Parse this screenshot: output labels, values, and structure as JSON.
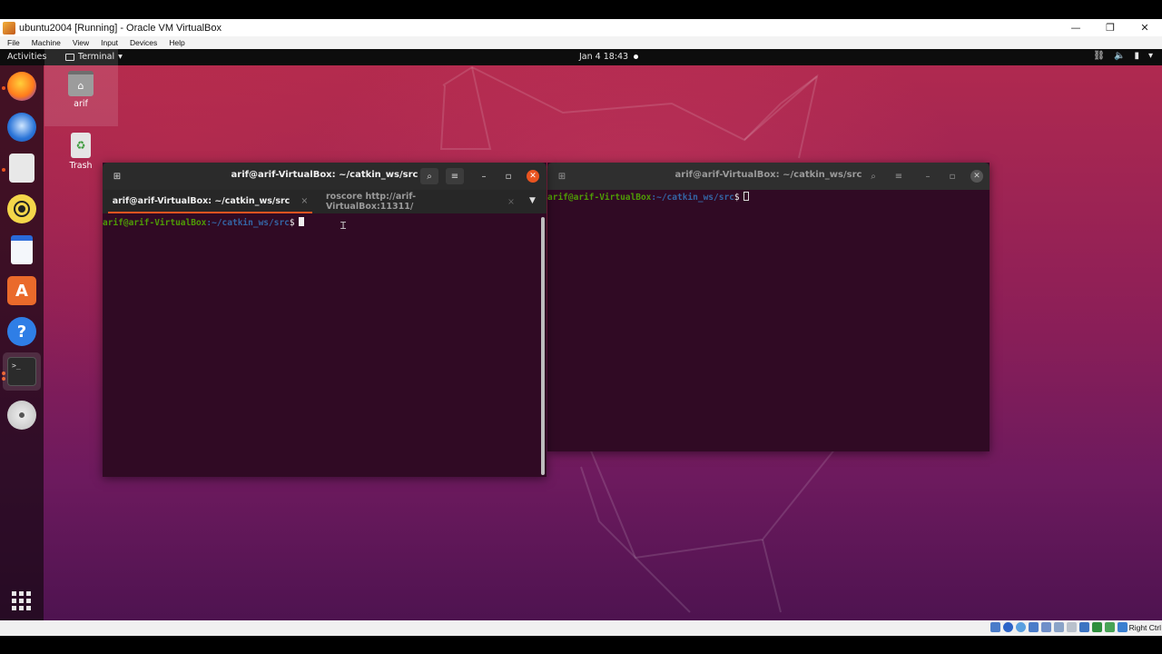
{
  "vbox": {
    "title": "ubuntu2004 [Running] - Oracle VM VirtualBox",
    "menu": [
      "File",
      "Machine",
      "View",
      "Input",
      "Devices",
      "Help"
    ],
    "host_key": "Right Ctrl"
  },
  "topbar": {
    "activities": "Activities",
    "app_menu": "Terminal",
    "clock": "Jan 4  18:43"
  },
  "dock": {
    "items": [
      "firefox-icon",
      "thunderbird-icon",
      "files-icon",
      "rhythmbox-icon",
      "writer-icon",
      "software-icon",
      "help-icon",
      "terminal-icon",
      "dvd-icon",
      "show-apps-icon"
    ]
  },
  "desktop": {
    "home_label": "arif",
    "trash_label": "Trash"
  },
  "terminal_left": {
    "title": "arif@arif-VirtualBox: ~/catkin_ws/src",
    "tabs": [
      {
        "label": "arif@arif-VirtualBox: ~/catkin_ws/src",
        "active": true
      },
      {
        "label": "roscore http://arif-VirtualBox:11311/",
        "active": false
      }
    ],
    "prompt_user": "arif@arif-VirtualBox",
    "prompt_path": ":~/catkin_ws/src",
    "prompt_sym": "$"
  },
  "terminal_right": {
    "title": "arif@arif-VirtualBox: ~/catkin_ws/src",
    "prompt_user": "arif@arif-VirtualBox",
    "prompt_path": ":~/catkin_ws/src",
    "prompt_sym": "$"
  },
  "colors": {
    "ubuntu_orange": "#e95420",
    "terminal_bg": "#300a24",
    "prompt_user": "#4e9a06",
    "prompt_path": "#3465a4"
  }
}
